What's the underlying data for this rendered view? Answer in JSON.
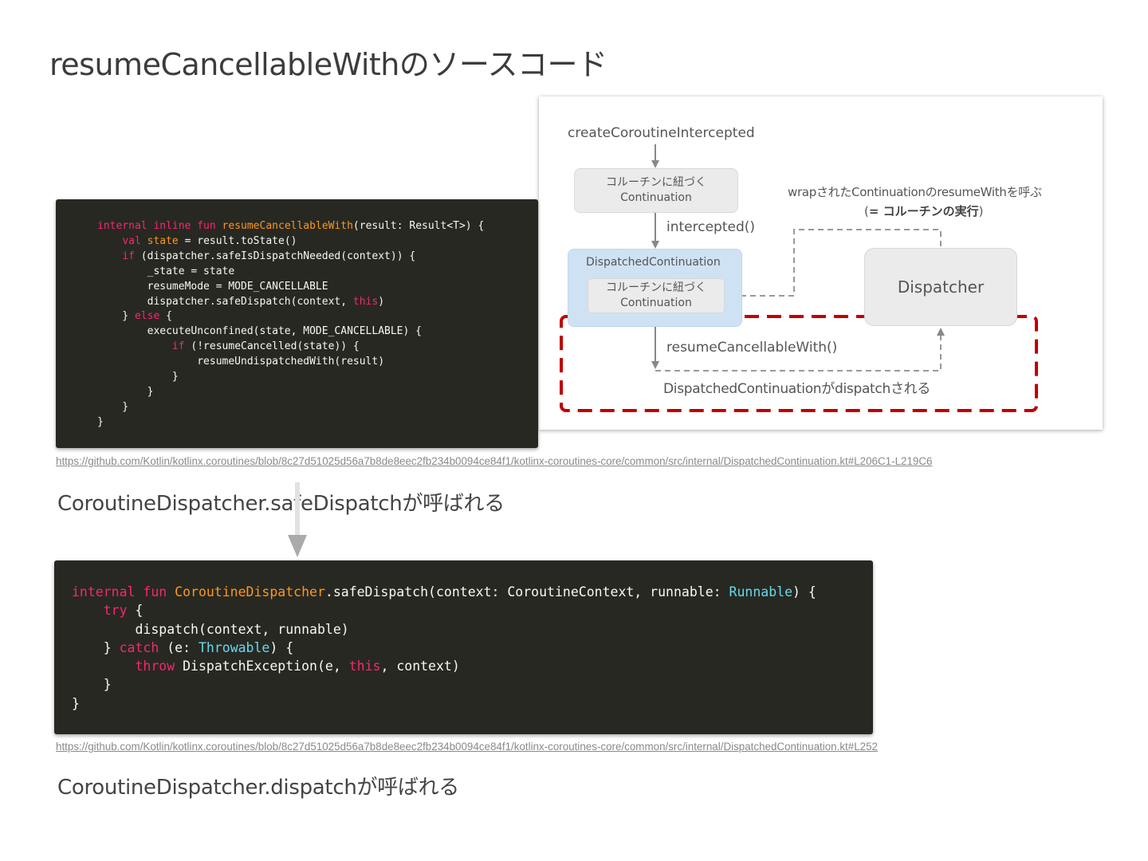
{
  "slide": {
    "title": "resumeCancellableWithのソースコード"
  },
  "diagram": {
    "create_label": "createCoroutineIntercepted",
    "continuation_box_line1": "コルーチンに紐づく",
    "continuation_box_line2": "Continuation",
    "intercepted_label": "intercepted()",
    "dispatched_label": "DispatchedContinuation",
    "inner_box_line1": "コルーチンに紐づく",
    "inner_box_line2": "Continuation",
    "dispatcher_label": "Dispatcher",
    "wrap_note_line1": "wrapされたContinuationのresumeWithを呼ぶ",
    "wrap_note_line2_open": "(",
    "wrap_note_line2_bold": "= コルーチンの実行",
    "wrap_note_line2_close": ")",
    "resume_label": "resumeCancellableWith()",
    "dispatch_label": "DispatchedContinuationがdispatchされる",
    "highlight_color": "#c00000",
    "accent_color": "#cfe2f3"
  },
  "code1": {
    "lines": [
      [
        {
          "t": "internal inline fun ",
          "c": "kw"
        },
        {
          "t": "resumeCancellableWith",
          "c": "fn"
        },
        {
          "t": "(result: Result<T>) {",
          "c": ""
        }
      ],
      [
        {
          "t": "    ",
          "c": ""
        },
        {
          "t": "val ",
          "c": "kw"
        },
        {
          "t": "state",
          "c": "fn"
        },
        {
          "t": " = result.toState()",
          "c": ""
        }
      ],
      [
        {
          "t": "    ",
          "c": ""
        },
        {
          "t": "if",
          "c": "kw"
        },
        {
          "t": " (dispatcher.safeIsDispatchNeeded(context)) {",
          "c": ""
        }
      ],
      [
        {
          "t": "        _state = state",
          "c": ""
        }
      ],
      [
        {
          "t": "        resumeMode = MODE_CANCELLABLE",
          "c": ""
        }
      ],
      [
        {
          "t": "        dispatcher.safeDispatch(context, ",
          "c": ""
        },
        {
          "t": "this",
          "c": "kw"
        },
        {
          "t": ")",
          "c": ""
        }
      ],
      [
        {
          "t": "    } ",
          "c": ""
        },
        {
          "t": "else",
          "c": "kw"
        },
        {
          "t": " {",
          "c": ""
        }
      ],
      [
        {
          "t": "        executeUnconfined(state, MODE_CANCELLABLE) {",
          "c": ""
        }
      ],
      [
        {
          "t": "            ",
          "c": ""
        },
        {
          "t": "if",
          "c": "kw"
        },
        {
          "t": " (!resumeCancelled(state)) {",
          "c": ""
        }
      ],
      [
        {
          "t": "                resumeUndispatchedWith(result)",
          "c": ""
        }
      ],
      [
        {
          "t": "            }",
          "c": ""
        }
      ],
      [
        {
          "t": "        }",
          "c": ""
        }
      ],
      [
        {
          "t": "    }",
          "c": ""
        }
      ],
      [
        {
          "t": "}",
          "c": ""
        }
      ]
    ]
  },
  "link1": {
    "text": "https://github.com/Kotlin/kotlinx.coroutines/blob/8c27d51025d56a7b8de8eec2fb234b0094ce84f1/kotlinx-coroutines-core/common/src/internal/DispatchedContinuation.kt#L206C1-L219C6"
  },
  "caption1": {
    "text": "CoroutineDispatcher.safeDispatchが呼ばれる"
  },
  "code2": {
    "lines": [
      [
        {
          "t": "internal fun ",
          "c": "kw"
        },
        {
          "t": "CoroutineDispatcher",
          "c": "fn"
        },
        {
          "t": ".safeDispatch(context: CoroutineContext, runnable: ",
          "c": ""
        },
        {
          "t": "Runnable",
          "c": "ty"
        },
        {
          "t": ") {",
          "c": ""
        }
      ],
      [
        {
          "t": "    ",
          "c": ""
        },
        {
          "t": "try",
          "c": "kw"
        },
        {
          "t": " {",
          "c": ""
        }
      ],
      [
        {
          "t": "        dispatch(context, runnable)",
          "c": ""
        }
      ],
      [
        {
          "t": "    } ",
          "c": ""
        },
        {
          "t": "catch",
          "c": "kw"
        },
        {
          "t": " (e: ",
          "c": ""
        },
        {
          "t": "Throwable",
          "c": "ty"
        },
        {
          "t": ") {",
          "c": ""
        }
      ],
      [
        {
          "t": "        ",
          "c": ""
        },
        {
          "t": "throw",
          "c": "kw"
        },
        {
          "t": " DispatchException(e, ",
          "c": ""
        },
        {
          "t": "this",
          "c": "kw"
        },
        {
          "t": ", context)",
          "c": ""
        }
      ],
      [
        {
          "t": "    }",
          "c": ""
        }
      ],
      [
        {
          "t": "}",
          "c": ""
        }
      ]
    ]
  },
  "link2": {
    "text": "https://github.com/Kotlin/kotlinx.coroutines/blob/8c27d51025d56a7b8de8eec2fb234b0094ce84f1/kotlinx-coroutines-core/common/src/internal/DispatchedContinuation.kt#L252"
  },
  "caption2": {
    "text": "CoroutineDispatcher.dispatchが呼ばれる"
  }
}
